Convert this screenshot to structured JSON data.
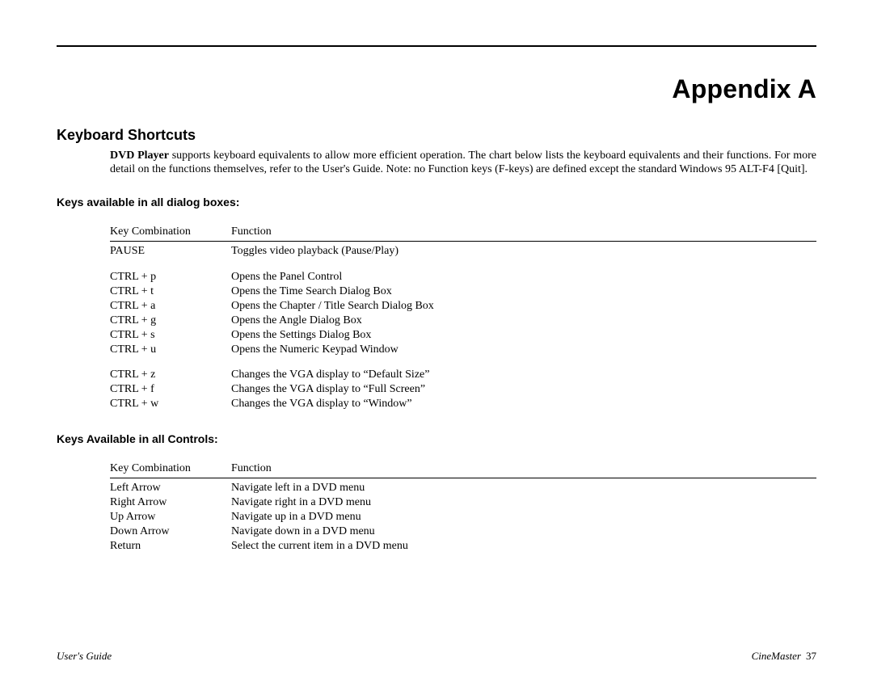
{
  "title": "Appendix A",
  "subtitle": "Keyboard Shortcuts",
  "intro_bold": "DVD Player",
  "intro_rest": " supports keyboard equivalents to allow more efficient operation.  The chart below lists the keyboard equivalents and their functions.  For more detail on the functions themselves, refer to the User's Guide.  Note: no Function keys (F-keys) are defined except the standard Windows 95 ALT-F4 [Quit].",
  "section1_head": "Keys available in all dialog boxes:",
  "section2_head": "Keys Available in all Controls:",
  "col_key": "Key Combination",
  "col_fn": "Function",
  "t1": [
    {
      "k": "PAUSE",
      "v": "Toggles video playback (Pause/Play)"
    }
  ],
  "t1b": [
    {
      "k": "CTRL + p",
      "v": "Opens the Panel Control"
    },
    {
      "k": "CTRL + t",
      "v": "Opens the Time Search Dialog Box"
    },
    {
      "k": "CTRL + a",
      "v": "Opens the Chapter / Title Search Dialog Box"
    },
    {
      "k": "CTRL + g",
      "v": "Opens the Angle Dialog Box"
    },
    {
      "k": "CTRL + s",
      "v": "Opens the Settings Dialog Box"
    },
    {
      "k": "CTRL + u",
      "v": "Opens the Numeric Keypad Window"
    }
  ],
  "t1c": [
    {
      "k": "CTRL + z",
      "v": "Changes the VGA display to “Default Size”"
    },
    {
      "k": "CTRL + f",
      "v": "Changes the VGA display to “Full Screen”"
    },
    {
      "k": "CTRL + w",
      "v": "Changes the VGA display to “Window”"
    }
  ],
  "t2": [
    {
      "k": "Left Arrow",
      "v": "Navigate left in a DVD menu"
    },
    {
      "k": "Right Arrow",
      "v": "Navigate right in a DVD menu"
    },
    {
      "k": "Up Arrow",
      "v": "Navigate up in a DVD menu"
    },
    {
      "k": "Down Arrow",
      "v": "Navigate down in a DVD menu"
    },
    {
      "k": "Return",
      "v": "Select the current item in a DVD menu"
    }
  ],
  "footer_left": "User's Guide",
  "footer_right_label": "CineMaster",
  "footer_right_page": "37"
}
